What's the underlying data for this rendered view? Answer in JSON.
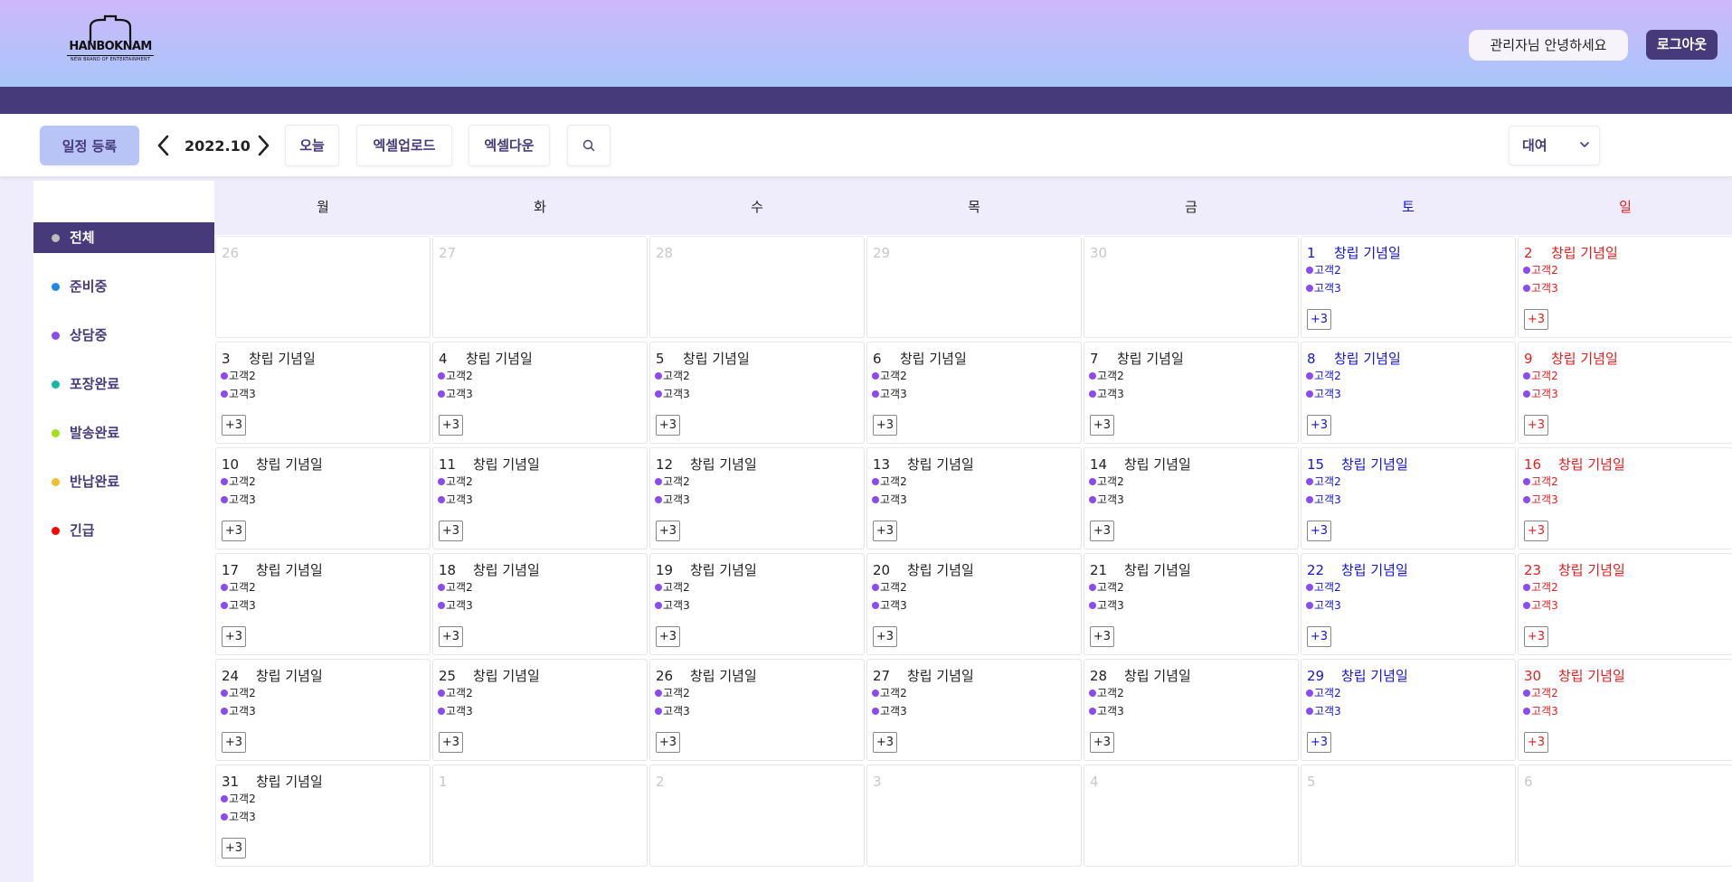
{
  "header": {
    "logo_text": "HANBOKNAM",
    "logo_tagline": "NEW BRAND OF ENTERTAINMENT",
    "greeting": "관리자님 안녕하세요",
    "logout_label": "로그아웃"
  },
  "toolbar": {
    "add_label": "일정 등록",
    "month": "2022.10",
    "today_label": "오늘",
    "excel_upload_label": "엑셀업로드",
    "excel_download_label": "엑셀다운",
    "select_value": "대여"
  },
  "sidebar": {
    "items": [
      {
        "label": "전체",
        "color": "#bdbdbd"
      },
      {
        "label": "준비중",
        "color": "#1e88e5"
      },
      {
        "label": "상담중",
        "color": "#8a4dec"
      },
      {
        "label": "포장완료",
        "color": "#14b8a6"
      },
      {
        "label": "발송완료",
        "color": "#a3e01b"
      },
      {
        "label": "반납완료",
        "color": "#f0c02c"
      },
      {
        "label": "긴급",
        "color": "#ff0000"
      }
    ]
  },
  "calendar": {
    "weekdays": [
      "월",
      "화",
      "수",
      "목",
      "금",
      "토",
      "일"
    ],
    "event_title": "창립 기념일",
    "customers": [
      "고객2",
      "고객3"
    ],
    "more_label": "+3",
    "saturday_color": "#1515d4",
    "sunday_color": "#e51e1e",
    "weeks": [
      [
        {
          "d": "26",
          "o": true
        },
        {
          "d": "27",
          "o": true
        },
        {
          "d": "28",
          "o": true
        },
        {
          "d": "29",
          "o": true
        },
        {
          "d": "30",
          "o": true
        },
        {
          "d": "1"
        },
        {
          "d": "2"
        }
      ],
      [
        {
          "d": "3"
        },
        {
          "d": "4"
        },
        {
          "d": "5"
        },
        {
          "d": "6"
        },
        {
          "d": "7"
        },
        {
          "d": "8"
        },
        {
          "d": "9"
        }
      ],
      [
        {
          "d": "10"
        },
        {
          "d": "11"
        },
        {
          "d": "12"
        },
        {
          "d": "13"
        },
        {
          "d": "14"
        },
        {
          "d": "15"
        },
        {
          "d": "16"
        }
      ],
      [
        {
          "d": "17"
        },
        {
          "d": "18"
        },
        {
          "d": "19"
        },
        {
          "d": "20"
        },
        {
          "d": "21"
        },
        {
          "d": "22"
        },
        {
          "d": "23"
        }
      ],
      [
        {
          "d": "24"
        },
        {
          "d": "25"
        },
        {
          "d": "26"
        },
        {
          "d": "27"
        },
        {
          "d": "28"
        },
        {
          "d": "29"
        },
        {
          "d": "30"
        }
      ],
      [
        {
          "d": "31"
        },
        {
          "d": "1",
          "o": true
        },
        {
          "d": "2",
          "o": true
        },
        {
          "d": "3",
          "o": true
        },
        {
          "d": "4",
          "o": true
        },
        {
          "d": "5",
          "o": true
        },
        {
          "d": "6",
          "o": true
        }
      ]
    ]
  }
}
